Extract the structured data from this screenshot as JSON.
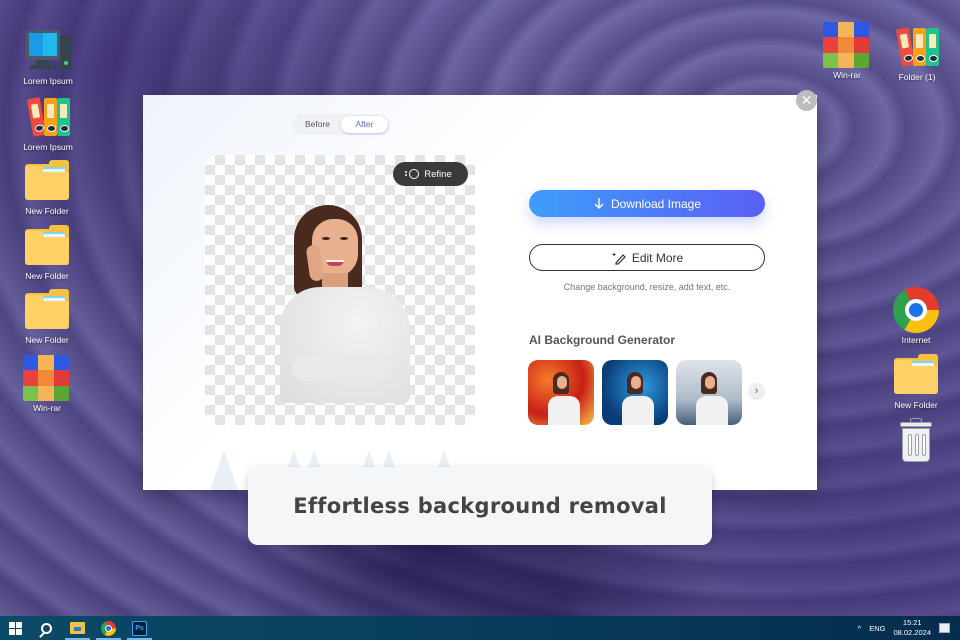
{
  "desktop": {
    "left_icons": [
      {
        "label": "Lorem Ipsum",
        "icon": "computer-icon"
      },
      {
        "label": "Lorem Ipsum",
        "icon": "binders-icon"
      },
      {
        "label": "New Folder",
        "icon": "folder-icon"
      },
      {
        "label": "New Folder",
        "icon": "folder-icon"
      },
      {
        "label": "New Folder",
        "icon": "folder-icon"
      },
      {
        "label": "Win-rar",
        "icon": "winrar-icon"
      }
    ],
    "top_right_icons": [
      {
        "label": "Win-rar",
        "icon": "winrar-icon"
      },
      {
        "label": "Folder (1)",
        "icon": "binders-icon"
      }
    ],
    "right_icons": [
      {
        "label": "Internet",
        "icon": "chrome-icon"
      },
      {
        "label": "New Folder",
        "icon": "folder-icon"
      },
      {
        "label": "",
        "icon": "trash-icon"
      }
    ]
  },
  "app": {
    "toggle": {
      "before": "Before",
      "after": "After",
      "selected": "After"
    },
    "refine_label": "Refine",
    "download_label": "Download Image",
    "edit_label": "Edit More",
    "edit_hint": "Change background, resize, add text, etc.",
    "ai_title": "AI Background Generator",
    "thumbnails": [
      {
        "name": "red-flowers-background"
      },
      {
        "name": "blue-space-background"
      },
      {
        "name": "snowy-mountain-background"
      }
    ],
    "close_symbol": "✕",
    "next_symbol": "›",
    "colors": {
      "download_start": "#3d9dfb",
      "download_end": "#5b5ff5",
      "toggle_active": "#5b6cf0"
    }
  },
  "caption": "Effortless background removal",
  "taskbar": {
    "apps": [
      "start",
      "search",
      "file-explorer",
      "chrome",
      "photoshop"
    ],
    "ps_label": "Ps",
    "tray": {
      "chevron": "^",
      "language": "ENG",
      "time": "15:21",
      "date": "08.02.2024"
    }
  }
}
